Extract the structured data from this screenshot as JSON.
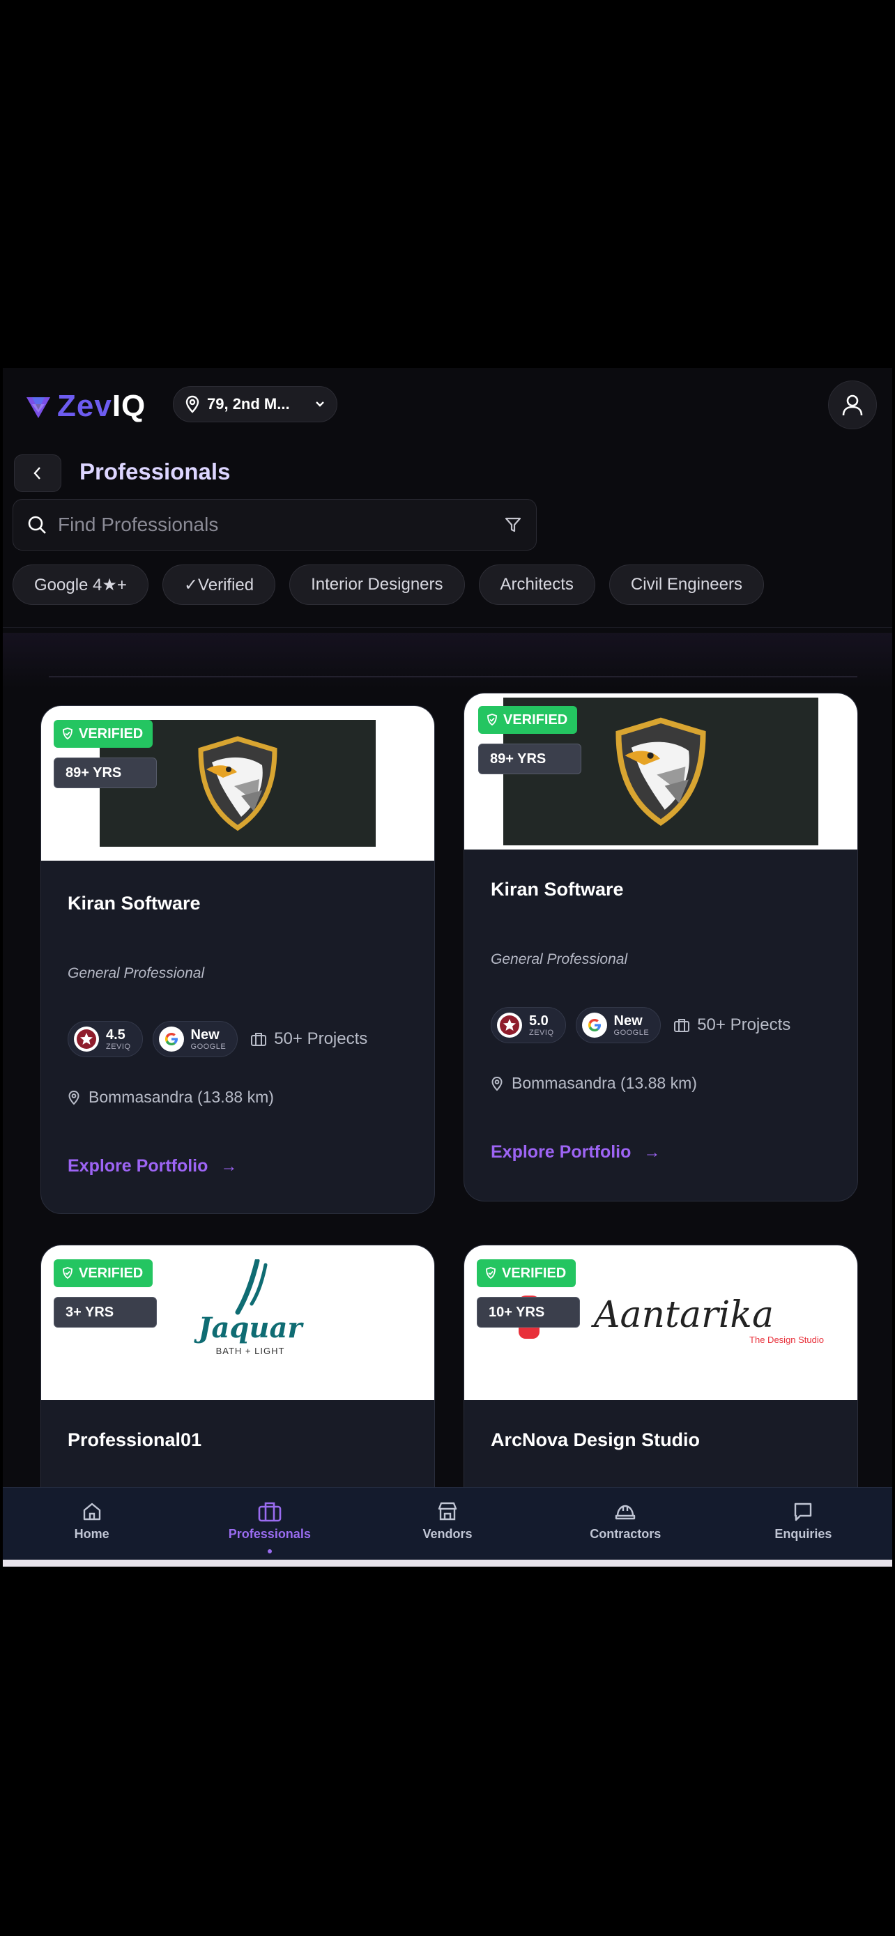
{
  "header": {
    "brand": {
      "part1": "Zev",
      "part2": "IQ"
    },
    "location": "79, 2nd M...",
    "icons": {
      "location": "map-pin-icon",
      "dropdown": "chevron-down-icon",
      "profile": "user-icon"
    }
  },
  "page": {
    "title": "Professionals",
    "back_icon": "chevron-left-icon"
  },
  "search": {
    "placeholder": "Find Professionals",
    "value": "",
    "icons": {
      "search": "search-icon",
      "filter": "filter-icon"
    }
  },
  "chips": [
    {
      "label": "Google 4★+"
    },
    {
      "label": "✓Verified"
    },
    {
      "label": "Interior Designers"
    },
    {
      "label": "Architects"
    },
    {
      "label": "Civil Engineers"
    }
  ],
  "cards": [
    {
      "verified": "VERIFIED",
      "years": "89+ YRS",
      "logo": "eagle-shield",
      "name": "Kiran Software",
      "category": "General Professional",
      "zeviq_rating": "4.5",
      "zeviq_label": "ZEVIQ",
      "google_rating": "New",
      "google_label": "GOOGLE",
      "projects": "50+ Projects",
      "location": "Bommasandra (13.88 km)",
      "cta": "Explore Portfolio"
    },
    {
      "verified": "VERIFIED",
      "years": "89+ YRS",
      "logo": "eagle-shield",
      "name": "Kiran Software",
      "category": "General Professional",
      "zeviq_rating": "5.0",
      "zeviq_label": "ZEVIQ",
      "google_rating": "New",
      "google_label": "GOOGLE",
      "projects": "50+ Projects",
      "location": "Bommasandra (13.88 km)",
      "cta": "Explore Portfolio"
    },
    {
      "verified": "VERIFIED",
      "years": "3+ YRS",
      "logo": "jaquar",
      "logo_text": "Jaquar",
      "logo_subtext": "BATH + LIGHT",
      "name": "Professional01"
    },
    {
      "verified": "VERIFIED",
      "years": "10+ YRS",
      "logo": "aantarika",
      "logo_text": "Aantarika",
      "logo_subtext": "The Design Studio",
      "name": "ArcNova Design Studio"
    }
  ],
  "bottom_nav": [
    {
      "label": "Home",
      "icon": "home-icon",
      "active": false
    },
    {
      "label": "Professionals",
      "icon": "briefcase-icon",
      "active": true
    },
    {
      "label": "Vendors",
      "icon": "store-icon",
      "active": false
    },
    {
      "label": "Contractors",
      "icon": "hard-hat-icon",
      "active": false
    },
    {
      "label": "Enquiries",
      "icon": "message-icon",
      "active": false
    }
  ],
  "colors": {
    "accent": "#9a6cf0",
    "verified": "#24c561",
    "card_bg": "#181b26",
    "nav_bg": "#141b2d"
  }
}
